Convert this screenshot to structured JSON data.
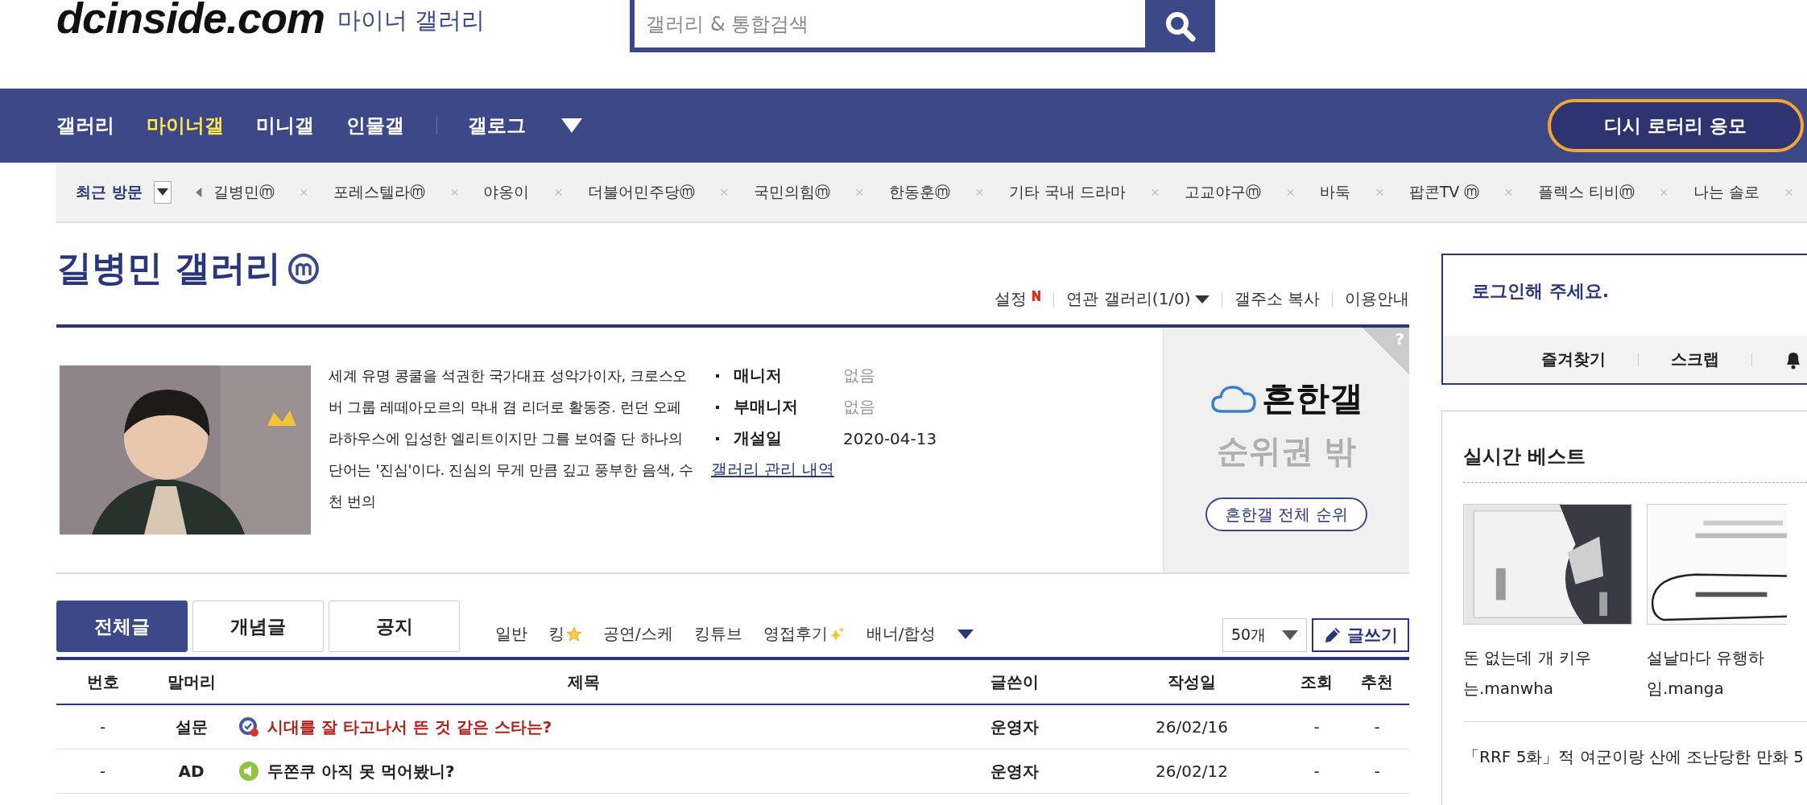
{
  "header": {
    "logo": "dcinside.com",
    "section": "마이너 갤러리",
    "search": {
      "placeholder": "갤러리 & 통합검색"
    }
  },
  "nav": {
    "items": [
      {
        "label": "갤러리",
        "selected": false
      },
      {
        "label": "마이너갤",
        "selected": true
      },
      {
        "label": "미니갤",
        "selected": false
      },
      {
        "label": "인물갤",
        "selected": false
      }
    ],
    "extra_items": [
      {
        "label": "갤로그",
        "selected": false
      }
    ],
    "lottery_button": "디시 로터리 응모"
  },
  "recent": {
    "label": "최근 방문",
    "items": [
      {
        "label": "길병민ⓜ"
      },
      {
        "label": "포레스텔라ⓜ"
      },
      {
        "label": "야옹이"
      },
      {
        "label": "더불어민주당ⓜ"
      },
      {
        "label": "국민의힘ⓜ"
      },
      {
        "label": "한동훈ⓜ"
      },
      {
        "label": "기타 국내 드라마"
      },
      {
        "label": "고교야구ⓜ"
      },
      {
        "label": "바둑"
      },
      {
        "label": "팝콘TV ⓜ"
      },
      {
        "label": "플렉스 티비ⓜ"
      },
      {
        "label": "나는 솔로"
      }
    ]
  },
  "gallery": {
    "title": "길병민 갤러리",
    "minor": true,
    "tools": [
      {
        "label": "설정",
        "kind": "new"
      },
      {
        "label": "연관 갤러리(1/0)",
        "kind": "dropdown"
      },
      {
        "label": "갤주소 복사",
        "kind": "plain"
      },
      {
        "label": "이용안내",
        "kind": "plain"
      }
    ],
    "description": "세계 유명 콩쿨을 석권한 국가대표 성악가이자, 크로스오버 그룹 레떼아모르의 막내 겸 리더로 활동중. 런던 오페라하우스에 입성한 엘리트이지만 그를 보여줄 단 하나의 단어는 '진심'이다. 진심의 무게 만큼 깊고 풍부한 음색, 수 천 번의",
    "info": [
      {
        "label": "매니저",
        "value": "없음",
        "muted": true
      },
      {
        "label": "부매니저",
        "value": "없음",
        "muted": true
      },
      {
        "label": "개설일",
        "value": "2020-04-13",
        "muted": false
      }
    ],
    "manage_link": "갤러리 관리 내역",
    "ranking": {
      "help": "?",
      "name": "흔한갤",
      "status": "순위권 밖",
      "button": "흔한갤 전체 순위"
    }
  },
  "tabs": [
    {
      "label": "전체글",
      "selected": true
    },
    {
      "label": "개념글",
      "selected": false
    },
    {
      "label": "공지",
      "selected": false
    }
  ],
  "categories": [
    {
      "label": "일반",
      "kind": "plain"
    },
    {
      "label": "킹",
      "kind": "star"
    },
    {
      "label": "공연/스케",
      "kind": "plain"
    },
    {
      "label": "킹튜브",
      "kind": "plain"
    },
    {
      "label": "영접후기",
      "kind": "sparkle"
    },
    {
      "label": "배너/합성",
      "kind": "plain"
    }
  ],
  "page_size": "50개",
  "write_button": "글쓰기",
  "table": {
    "columns": [
      "번호",
      "말머리",
      "제목",
      "글쓴이",
      "작성일",
      "조회",
      "추천"
    ],
    "rows": [
      {
        "number": "-",
        "head": "설문",
        "kind": "survey",
        "title": "시대를 잘 타고나서 뜬 것 같은 스타는?",
        "writer": "운영자",
        "date": "26/02/16",
        "views": "-",
        "votes": "-"
      },
      {
        "number": "-",
        "head": "AD",
        "kind": "ad",
        "title": "두쫀쿠 아직 못 먹어봤니?",
        "writer": "운영자",
        "date": "26/02/12",
        "views": "-",
        "votes": "-"
      }
    ]
  },
  "sidebar": {
    "login": {
      "prompt": "로그인해 주세요.",
      "links": [
        "즐겨찾기",
        "스크랩"
      ]
    },
    "best": {
      "title": "실시간 베스트",
      "cards": [
        {
          "lines": [
            "돈 없는데 개 키우",
            "는.manwha"
          ]
        },
        {
          "lines": [
            "설날마다 유행하",
            "임.manga"
          ]
        }
      ],
      "list": [
        "「RRF 5화」적 여군이랑 산에 조난당한 만화 5"
      ]
    }
  }
}
